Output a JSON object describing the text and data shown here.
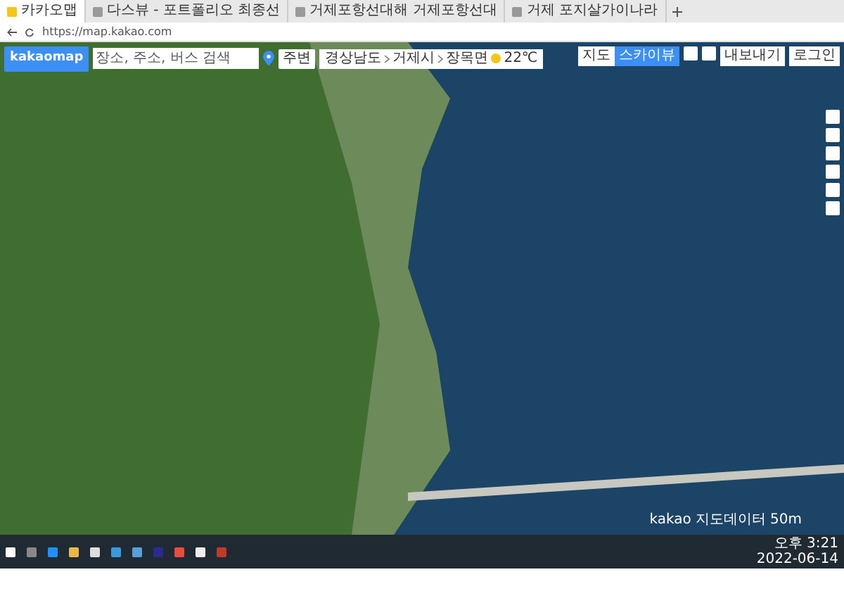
{
  "browser": {
    "tabs": [
      {
        "label": "카카오맵",
        "selected": true
      },
      {
        "label": "다스뷰 - 포트폴리오 최종선",
        "selected": false
      },
      {
        "label": "거제포항선대해 거제포항선대",
        "selected": false
      },
      {
        "label": "거제 포지살가이나라",
        "selected": false
      }
    ],
    "address": "https://map.kakao.com"
  },
  "map": {
    "logo": "kakaomap",
    "search": {
      "placeholder": "장소, 주소, 버스 검색"
    },
    "nearby": "주변",
    "breadcrumb": [
      "경상남도",
      "거제시",
      "장목면"
    ],
    "weather": "22℃",
    "map_types": [
      {
        "label": "지도",
        "selected": false
      },
      {
        "label": "스카이뷰",
        "selected": true
      }
    ],
    "export": "내보내기",
    "login": "로그인",
    "attribution": "kakao 지도데이터",
    "scale": "50m"
  },
  "taskbar": {
    "time": "오후 3:21",
    "date": "2022-06-14"
  }
}
